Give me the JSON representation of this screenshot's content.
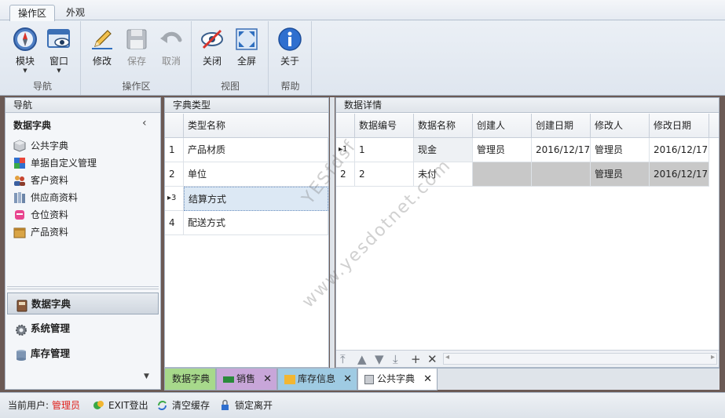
{
  "ribbon": {
    "tabs": [
      "操作区",
      "外观"
    ],
    "groups": [
      {
        "label": "导航",
        "buttons": [
          {
            "label": "模块",
            "icon": "compass-icon"
          },
          {
            "label": "窗口",
            "icon": "window-icon"
          }
        ]
      },
      {
        "label": "操作区",
        "buttons": [
          {
            "label": "修改",
            "icon": "pencil-icon"
          },
          {
            "label": "保存",
            "icon": "floppy-disk-icon"
          },
          {
            "label": "取消",
            "icon": "undo-icon"
          }
        ]
      },
      {
        "label": "视图",
        "buttons": [
          {
            "label": "关闭",
            "icon": "eye-closed-icon"
          },
          {
            "label": "全屏",
            "icon": "fullscreen-icon"
          }
        ]
      },
      {
        "label": "帮助",
        "buttons": [
          {
            "label": "关于",
            "icon": "info-icon"
          }
        ]
      }
    ]
  },
  "nav": {
    "title": "导航",
    "group": "数据字典",
    "collapse_glyph": "‹",
    "items": [
      {
        "label": "公共字典",
        "icon": "box-icon"
      },
      {
        "label": "单据自定义管理",
        "icon": "puzzle-icon"
      },
      {
        "label": "客户资料",
        "icon": "users-icon"
      },
      {
        "label": "供应商资料",
        "icon": "books-icon"
      },
      {
        "label": "仓位资料",
        "icon": "shelf-icon"
      },
      {
        "label": "产品资料",
        "icon": "package-icon"
      }
    ],
    "modules": [
      {
        "label": "数据字典",
        "icon": "dictionary-icon"
      },
      {
        "label": "系统管理",
        "icon": "gear-icon"
      },
      {
        "label": "库存管理",
        "icon": "database-icon"
      }
    ],
    "more_glyph": "▼"
  },
  "dict_types": {
    "title": "字典类型",
    "column": "类型名称",
    "rows": [
      {
        "num": "1",
        "name": "产品材质"
      },
      {
        "num": "2",
        "name": "单位"
      },
      {
        "num": "3",
        "name": "结算方式"
      },
      {
        "num": "4",
        "name": "配送方式"
      }
    ],
    "current_row_marker": "▸"
  },
  "details": {
    "title": "数据详情",
    "columns": [
      "数据编号",
      "数据名称",
      "创建人",
      "创建日期",
      "修改人",
      "修改日期"
    ],
    "rows": [
      {
        "num": "1",
        "cells": [
          "1",
          "现金",
          "管理员",
          "2016/12/17",
          "管理员",
          "2016/12/17"
        ]
      },
      {
        "num": "2",
        "cells": [
          "2",
          "未付",
          "",
          "",
          "管理员",
          "2016/12/17"
        ]
      }
    ],
    "toolbar": [
      "⤒",
      "▲",
      "▼",
      "⤓",
      "+",
      "✕"
    ],
    "scroll_left": "◂",
    "scroll_right": "▸"
  },
  "watermark": {
    "line1": "YESfdsf",
    "line2": "www.yesdotnet.com"
  },
  "doc_tabs": [
    {
      "label": "数据字典",
      "color": "#a7d98b"
    },
    {
      "label": "销售",
      "color": "#c8a6d9",
      "icon": "sales-icon"
    },
    {
      "label": "库存信息",
      "color": "#9fcbe3",
      "icon": "folder-icon"
    },
    {
      "label": "公共字典",
      "color": "#ffffff",
      "icon": "box-icon"
    }
  ],
  "tab_close_glyph": "✕",
  "status": {
    "user_label": "当前用户:",
    "user_name": "管理员",
    "user_color": "#e0201b",
    "exit": "EXIT登出",
    "clear_cache": "清空缓存",
    "lock": "锁定离开"
  }
}
